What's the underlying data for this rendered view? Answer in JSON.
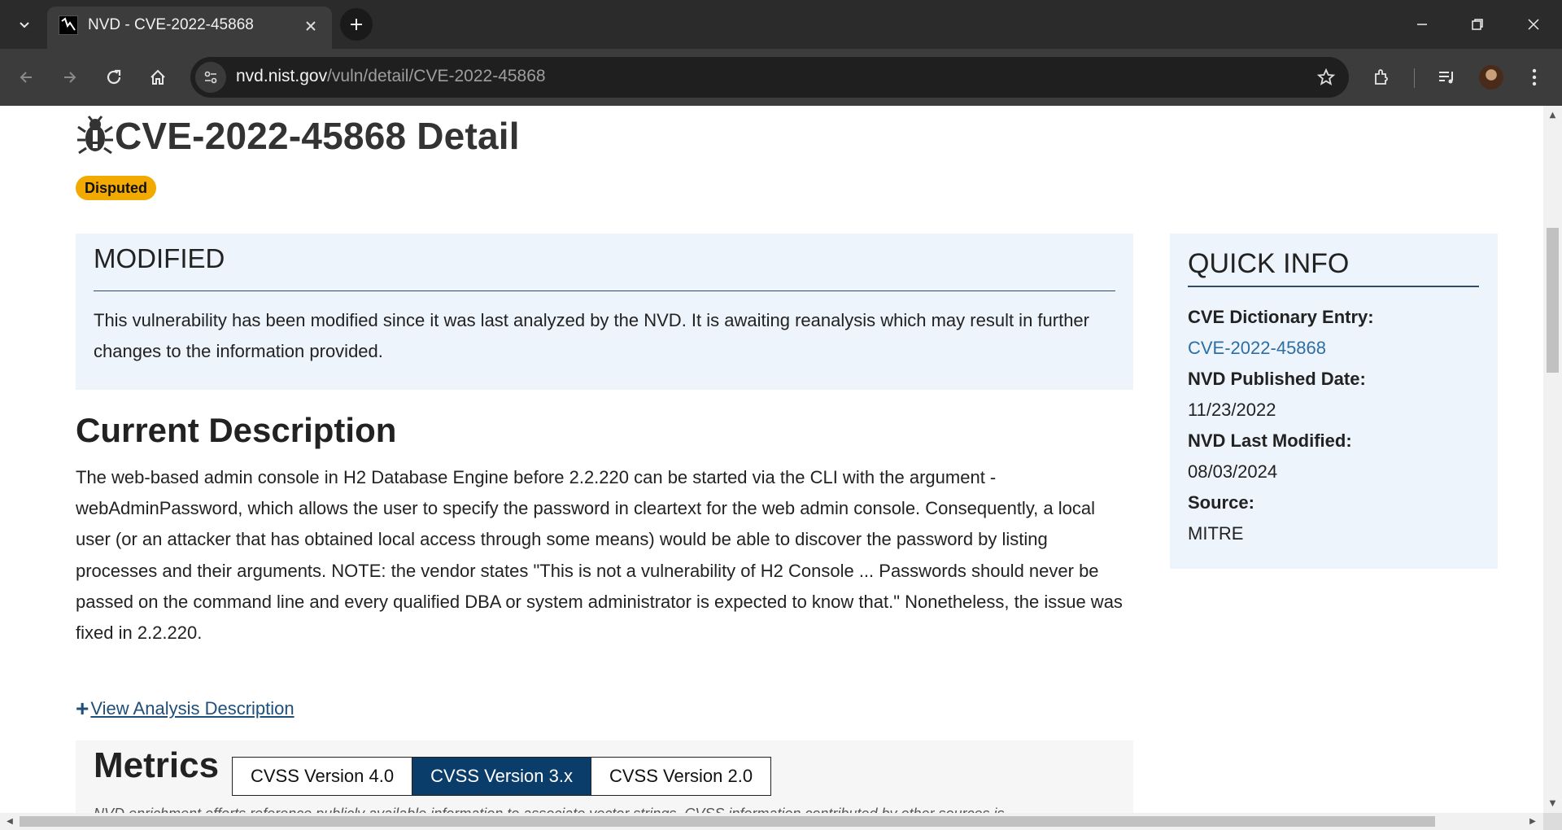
{
  "browser": {
    "tab_title": "NVD - CVE-2022-45868",
    "url_host": "nvd.nist.gov",
    "url_path": "/vuln/detail/CVE-2022-45868"
  },
  "page": {
    "title": "CVE-2022-45868 Detail",
    "badge": "Disputed",
    "modified": {
      "heading": "MODIFIED",
      "text": "This vulnerability has been modified since it was last analyzed by the NVD. It is awaiting reanalysis which may result in further changes to the information provided."
    },
    "description": {
      "heading": "Current Description",
      "text": "The web-based admin console in H2 Database Engine before 2.2.220 can be started via the CLI with the argument -webAdminPassword, which allows the user to specify the password in cleartext for the web admin console. Consequently, a local user (or an attacker that has obtained local access through some means) would be able to discover the password by listing processes and their arguments. NOTE: the vendor states \"This is not a vulnerability of H2 Console ... Passwords should never be passed on the command line and every qualified DBA or system administrator is expected to know that.\" Nonetheless, the issue was fixed in 2.2.220."
    },
    "view_analysis_label": "View Analysis Description",
    "metrics": {
      "heading": "Metrics",
      "tabs": [
        "CVSS Version 4.0",
        "CVSS Version 3.x",
        "CVSS Version 2.0"
      ],
      "active_tab": "CVSS Version 3.x",
      "note": "NVD enrichment efforts reference publicly available information to associate vector strings. CVSS information contributed by other sources is"
    },
    "quick_info": {
      "heading": "QUICK INFO",
      "cve_entry_label": "CVE Dictionary Entry:",
      "cve_entry_value": "CVE-2022-45868",
      "published_label": "NVD Published Date:",
      "published_value": "11/23/2022",
      "modified_label": "NVD Last Modified:",
      "modified_value": "08/03/2024",
      "source_label": "Source:",
      "source_value": "MITRE"
    }
  },
  "colors": {
    "badge": "#f2a900",
    "panel_bg": "#edf4fc",
    "active_tab": "#0b3d6b",
    "link": "#1f4e79"
  },
  "icons": [
    "tab-list-icon",
    "nvd-favicon",
    "close-icon",
    "plus-icon",
    "minimize-icon",
    "restore-icon",
    "back-icon",
    "forward-icon",
    "reload-icon",
    "home-icon",
    "site-info-icon",
    "star-icon",
    "extensions-icon",
    "media-icon",
    "kebab-menu-icon",
    "bug-icon"
  ]
}
